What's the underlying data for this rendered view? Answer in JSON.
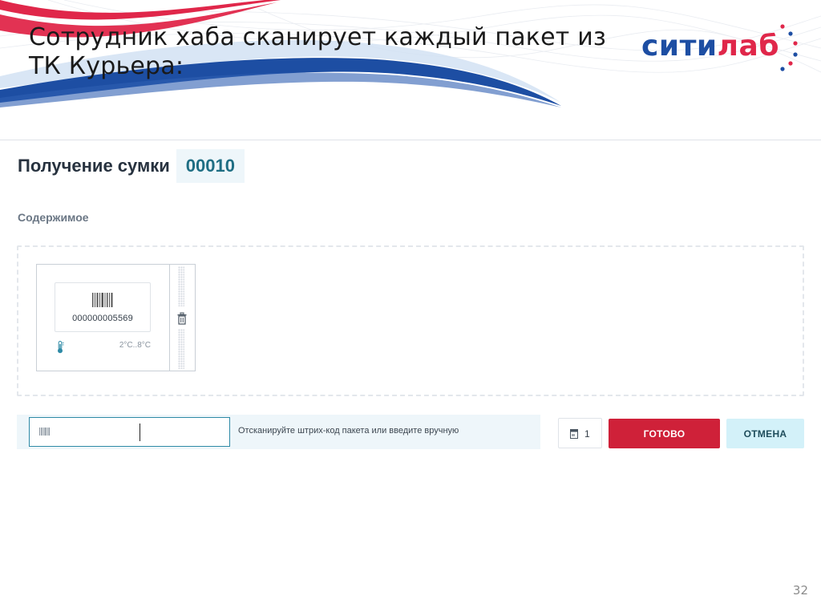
{
  "slide": {
    "title": "Сотрудник хаба сканирует каждый пакет из  ТК Курьера:",
    "page_number": "32"
  },
  "logo": {
    "part1": "сити",
    "part2": "лаб",
    "colors": {
      "blue": "#1d4ea3",
      "red": "#e0274a"
    }
  },
  "app": {
    "heading": "Получение сумки",
    "bag_number": "00010",
    "content_label": "Содержимое",
    "package": {
      "code": "000000005569",
      "temperature": "2°C..8°C",
      "icons": [
        "barcode-icon",
        "thermometer-icon",
        "trash-icon"
      ]
    },
    "scan": {
      "input_value": "",
      "hint": "Отсканируйте штрих-код пакета или введите вручную"
    },
    "count": "1",
    "buttons": {
      "done": "ГОТОВО",
      "cancel": "ОТМЕНА"
    },
    "colors": {
      "accent": "#2e8aa6",
      "done_button": "#cf2139",
      "cancel_button": "#d3f1f9",
      "bag_number": "#1f6e84"
    }
  }
}
